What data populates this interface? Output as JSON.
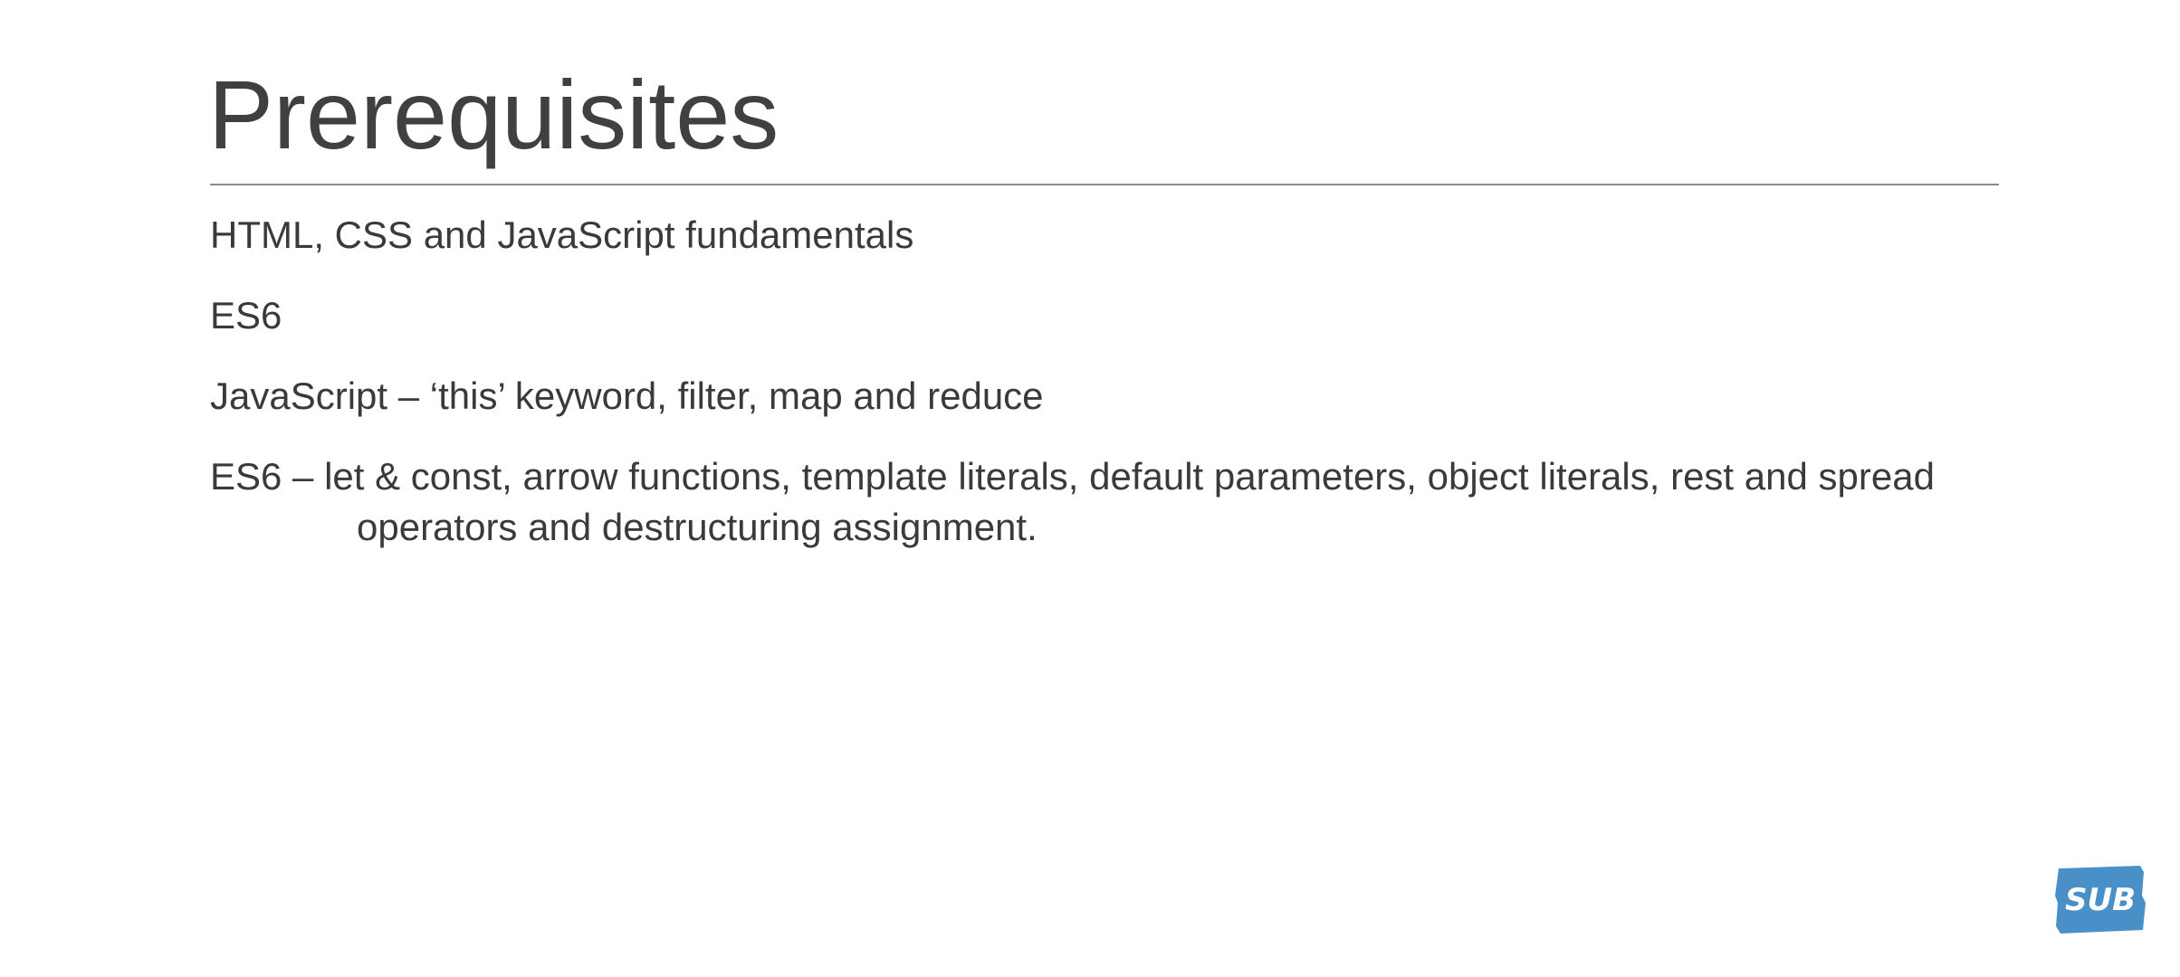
{
  "slide": {
    "title": "Prerequisites",
    "bullets": [
      "HTML, CSS and JavaScript fundamentals",
      "ES6",
      "JavaScript – ‘this’ keyword, filter, map and reduce",
      "ES6 – let & const, arrow functions, template literals, default parameters, object literals, rest and spread operators and destructuring assignment."
    ]
  },
  "badge": {
    "text": "SUB",
    "icon": "sub-badge-icon",
    "color": "#4a90c8",
    "text_color": "#ffffff"
  },
  "colors": {
    "title": "#404040",
    "body_text": "#3a3a3a",
    "rule": "#8c8c8c",
    "background": "#ffffff"
  }
}
